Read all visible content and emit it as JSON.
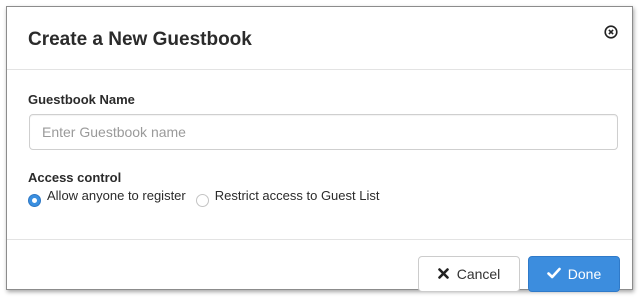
{
  "dialog": {
    "title": "Create a New Guestbook",
    "close_icon": "close-circle-icon"
  },
  "form": {
    "name_label": "Guestbook Name",
    "name_placeholder": "Enter Guestbook name",
    "name_value": "",
    "access_label": "Access control",
    "access_options": [
      {
        "label": "Allow anyone to register",
        "selected": true
      },
      {
        "label": "Restrict access to Guest List",
        "selected": false
      }
    ]
  },
  "footer": {
    "cancel_label": "Cancel",
    "cancel_icon": "x-icon",
    "done_label": "Done",
    "done_icon": "check-icon"
  },
  "colors": {
    "accent": "#3c8dde",
    "title_text": "#2b2b2b",
    "border": "#cfcfcf"
  }
}
